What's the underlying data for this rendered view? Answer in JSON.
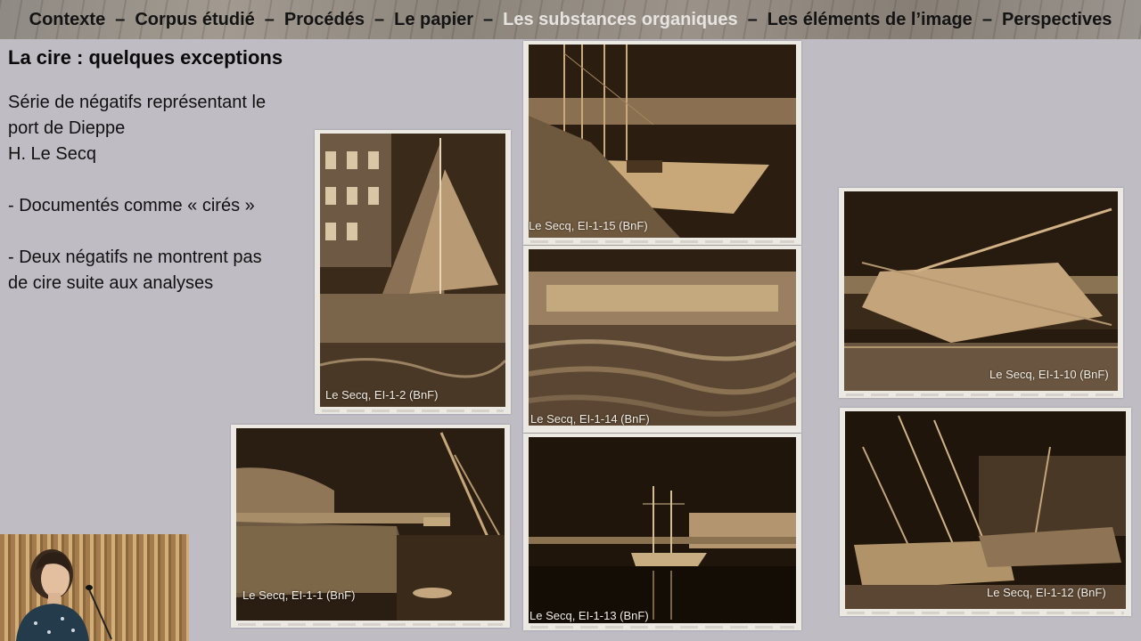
{
  "nav": {
    "items": [
      "Contexte",
      "Corpus étudié",
      "Procédés",
      "Le papier",
      "Les substances organiques",
      "Les éléments de l’image",
      "Perspectives"
    ],
    "active_index": 4,
    "separator": "–"
  },
  "title": "La cire : quelques exceptions",
  "description": "Série de négatifs représentant le\nport de Dieppe\nH. Le Secq\n\n- Documentés comme « cirés »\n\n- Deux négatifs ne montrent pas\nde cire suite aux analyses",
  "photos": [
    {
      "caption": "Le Secq, EI-1-2 (BnF)"
    },
    {
      "caption": "Le Secq, EI-1-15 (BnF)"
    },
    {
      "caption": "Le Secq, EI-1-14 (BnF)"
    },
    {
      "caption": "Le Secq, EI-1-13 (BnF)"
    },
    {
      "caption": "Le Secq, EI-1-1 (BnF)"
    },
    {
      "caption": "Le Secq, EI-1-10 (BnF)"
    },
    {
      "caption": "Le Secq, EI-1-12 (BnF)"
    }
  ],
  "colors": {
    "background": "#bfbcc4",
    "nav_active": "#e6e3e0",
    "negative_dark": "#2a1c10",
    "negative_light": "#c9a877"
  },
  "webcam": {
    "icon": "presenter-video"
  }
}
